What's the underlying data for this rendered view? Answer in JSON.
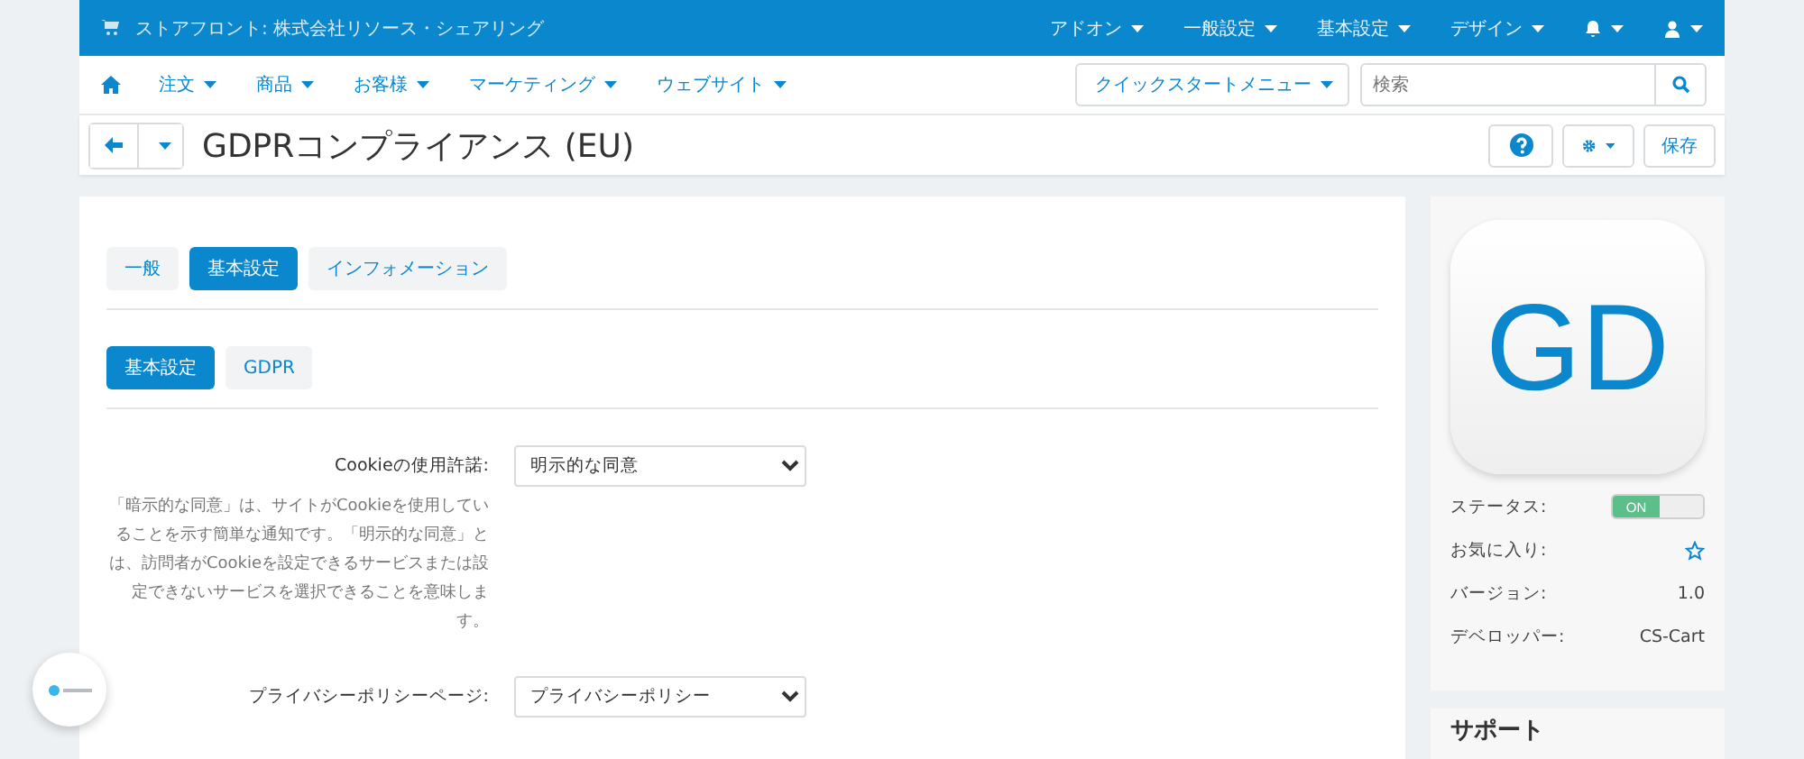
{
  "top_bar": {
    "store_title": "ストアフロント: 株式会社リソース・シェアリング",
    "menus": [
      "アドオン",
      "一般設定",
      "基本設定",
      "デザイン"
    ]
  },
  "nav": {
    "items": [
      "注文",
      "商品",
      "お客様",
      "マーケティング",
      "ウェブサイト"
    ],
    "quick_start": "クイックスタートメニュー",
    "search": {
      "placeholder": "検索"
    }
  },
  "title_bar": {
    "title": "GDPRコンプライアンス (EU)",
    "save_button": "保存"
  },
  "tabs": [
    {
      "label": "一般",
      "selected": false
    },
    {
      "label": "基本設定",
      "selected": true
    },
    {
      "label": "インフォメーション",
      "selected": false
    }
  ],
  "subtabs": [
    {
      "label": "基本設定",
      "selected": true
    },
    {
      "label": "GDPR",
      "selected": false
    }
  ],
  "fields": [
    {
      "label": "Cookieの使用許諾:",
      "value": "明示的な同意",
      "help": "「暗示的な同意」は、サイトがCookieを使用していることを示す簡単な通知です。「明示的な同意」とは、訪問者がCookieを設定できるサービスまたは設定できないサービスを選択できることを意味します。"
    },
    {
      "label": "プライバシーポリシーページ:",
      "value": "プライバシーポリシー"
    }
  ],
  "addon_card": {
    "logo_text": "GD",
    "rows": [
      {
        "kind": "toggle",
        "label": "ステータス:",
        "on": true,
        "on_label": "ON"
      },
      {
        "kind": "favorite",
        "label": "お気に入り:",
        "checked": false
      },
      {
        "kind": "text",
        "label": "バージョン:",
        "value": "1.0"
      },
      {
        "kind": "text",
        "label": "デベロッパー:",
        "value": "CS-Cart"
      }
    ]
  },
  "support_card": {
    "title": "サポート"
  }
}
